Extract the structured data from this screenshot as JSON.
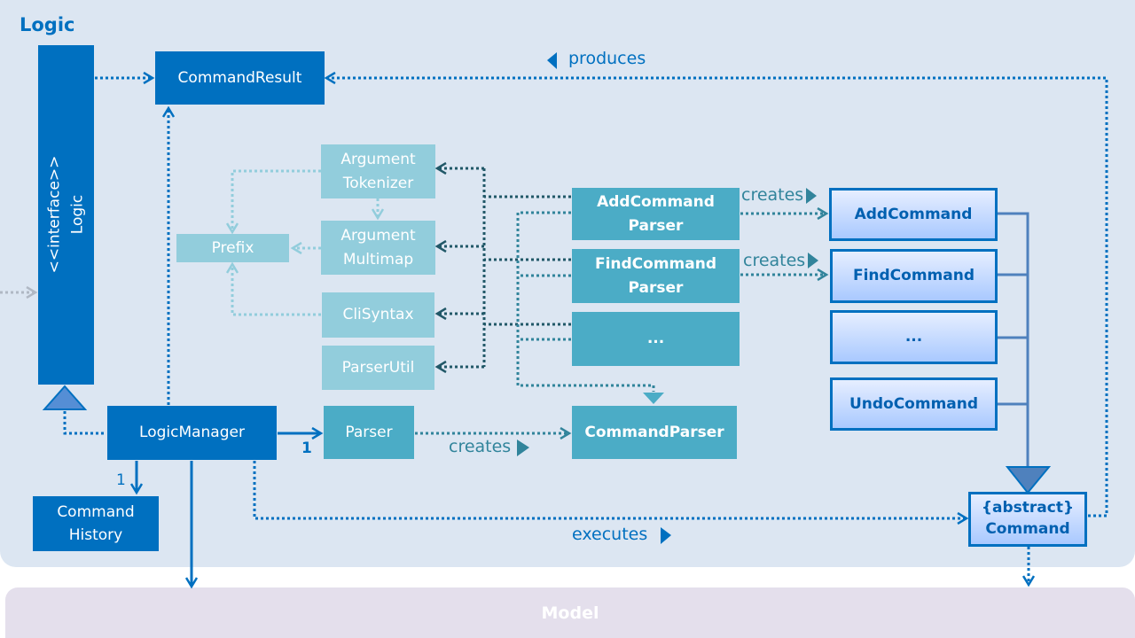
{
  "packages": {
    "logic": "Logic",
    "model": "Model"
  },
  "interface": {
    "stereotype": "<<interface>>",
    "name": "Logic"
  },
  "classes": {
    "command_result": "CommandResult",
    "argument_tokenizer": [
      "Argument",
      "Tokenizer"
    ],
    "argument_multimap": [
      "Argument",
      "Multimap"
    ],
    "prefix": "Prefix",
    "cli_syntax": "CliSyntax",
    "parser_util": "ParserUtil",
    "add_command_parser": [
      "AddCommand",
      "Parser"
    ],
    "find_command_parser": [
      "FindCommand",
      "Parser"
    ],
    "more_parsers": "...",
    "command_parser": "CommandParser",
    "logic_manager": "LogicManager",
    "parser": "Parser",
    "command_history": [
      "Command",
      "History"
    ],
    "add_command": "AddCommand",
    "find_command": "FindCommand",
    "more_commands": "...",
    "undo_command": "UndoCommand",
    "abstract_command": [
      "{abstract}",
      "Command"
    ]
  },
  "labels": {
    "produces": "produces",
    "creates_add": "creates",
    "creates_find": "creates",
    "creates_parser": "creates",
    "executes": "executes",
    "multiplicity_parser": "1",
    "multiplicity_history": "1"
  },
  "colors": {
    "logic_bg": "#dce6f2",
    "model_bg": "#e4dfec",
    "dark_blue": "#0070c0",
    "teal": "#4bacc6",
    "light_teal": "#92cddc",
    "dark_teal": "#215868"
  }
}
